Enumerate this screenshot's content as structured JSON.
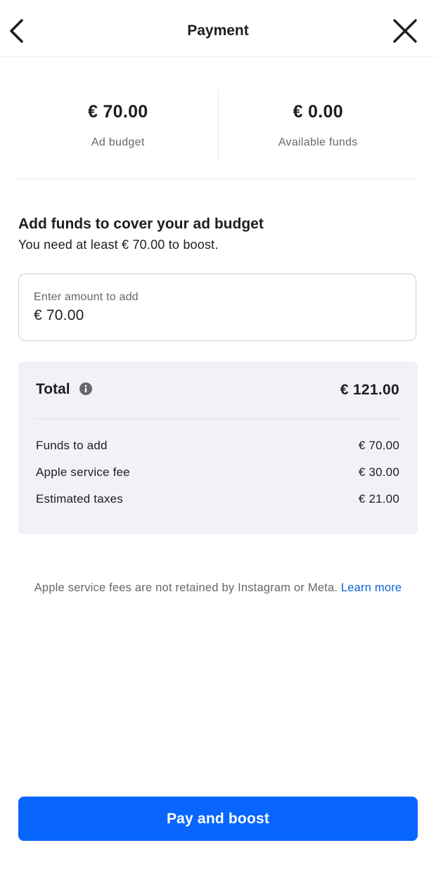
{
  "header": {
    "title": "Payment",
    "back_icon": "chevron-left-icon",
    "close_icon": "close-icon"
  },
  "summary": {
    "ad_budget": {
      "amount": "€ 70.00",
      "label": "Ad budget"
    },
    "available_funds": {
      "amount": "€ 0.00",
      "label": "Available funds"
    }
  },
  "add_funds": {
    "title": "Add funds to cover your ad budget",
    "subtitle": "You need at least € 70.00 to boost.",
    "input_label": "Enter amount to add",
    "input_value": "€ 70.00"
  },
  "total": {
    "label": "Total",
    "info_icon": "info-icon",
    "value": "€ 121.00",
    "items": [
      {
        "label": "Funds to add",
        "value": "€ 70.00"
      },
      {
        "label": "Apple service fee",
        "value": "€ 30.00"
      },
      {
        "label": "Estimated taxes",
        "value": "€ 21.00"
      }
    ]
  },
  "disclaimer": {
    "text": "Apple service fees are not retained by Instagram or Meta. ",
    "link": "Learn more"
  },
  "cta": {
    "label": "Pay and boost"
  },
  "colors": {
    "primary_button": "#0866ff",
    "link": "#0a66d8",
    "card_background": "#f1f2f6",
    "secondary_text": "#65676b"
  }
}
